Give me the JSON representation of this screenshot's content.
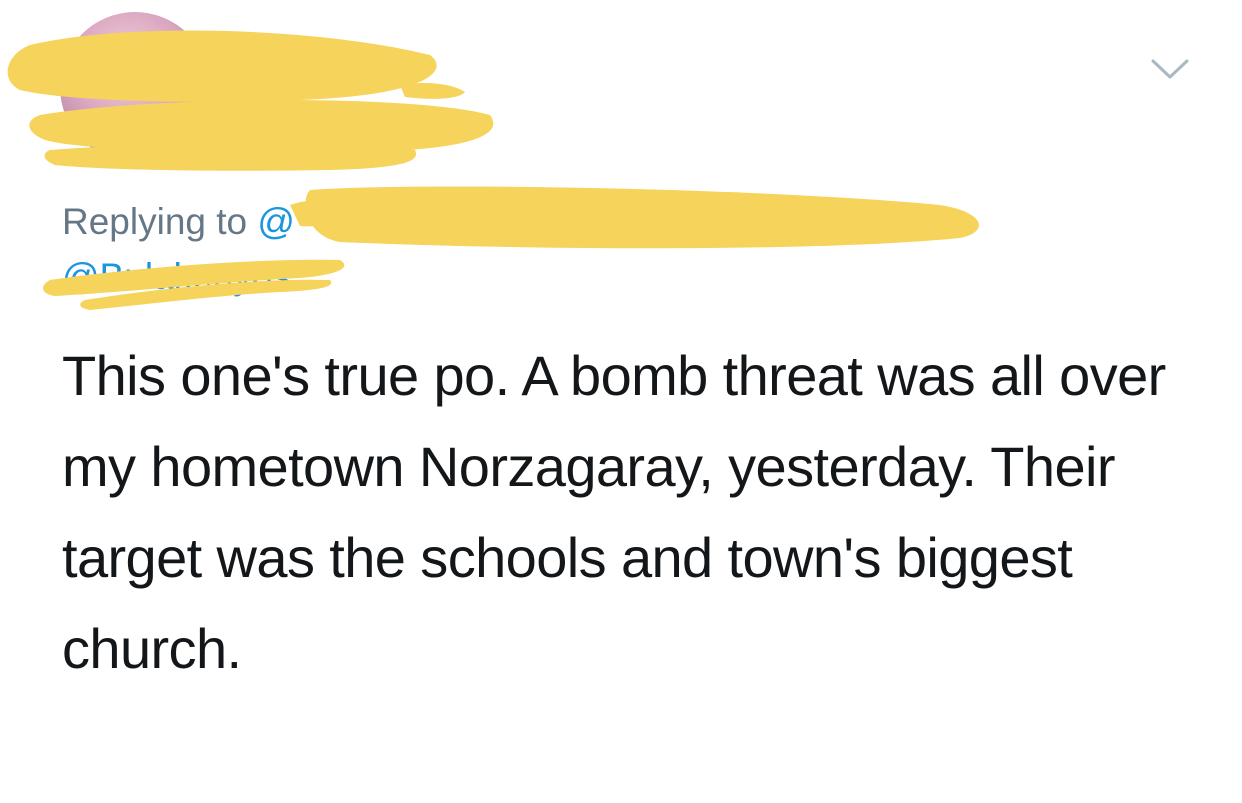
{
  "reply": {
    "prefix": "Replying to ",
    "handle_1": "@",
    "handle_2": "@Bulakenyos"
  },
  "tweet": {
    "text": "This one's true po. A bomb threat was all over my hometown Norzagaray, yesterday. Their target was the schools and town's biggest church."
  },
  "icons": {
    "more": "chevron-down-icon"
  },
  "colors": {
    "link": "#1b95e0",
    "secondary_text": "#657786",
    "primary_text": "#14171a",
    "redaction": "#f6d35b"
  }
}
